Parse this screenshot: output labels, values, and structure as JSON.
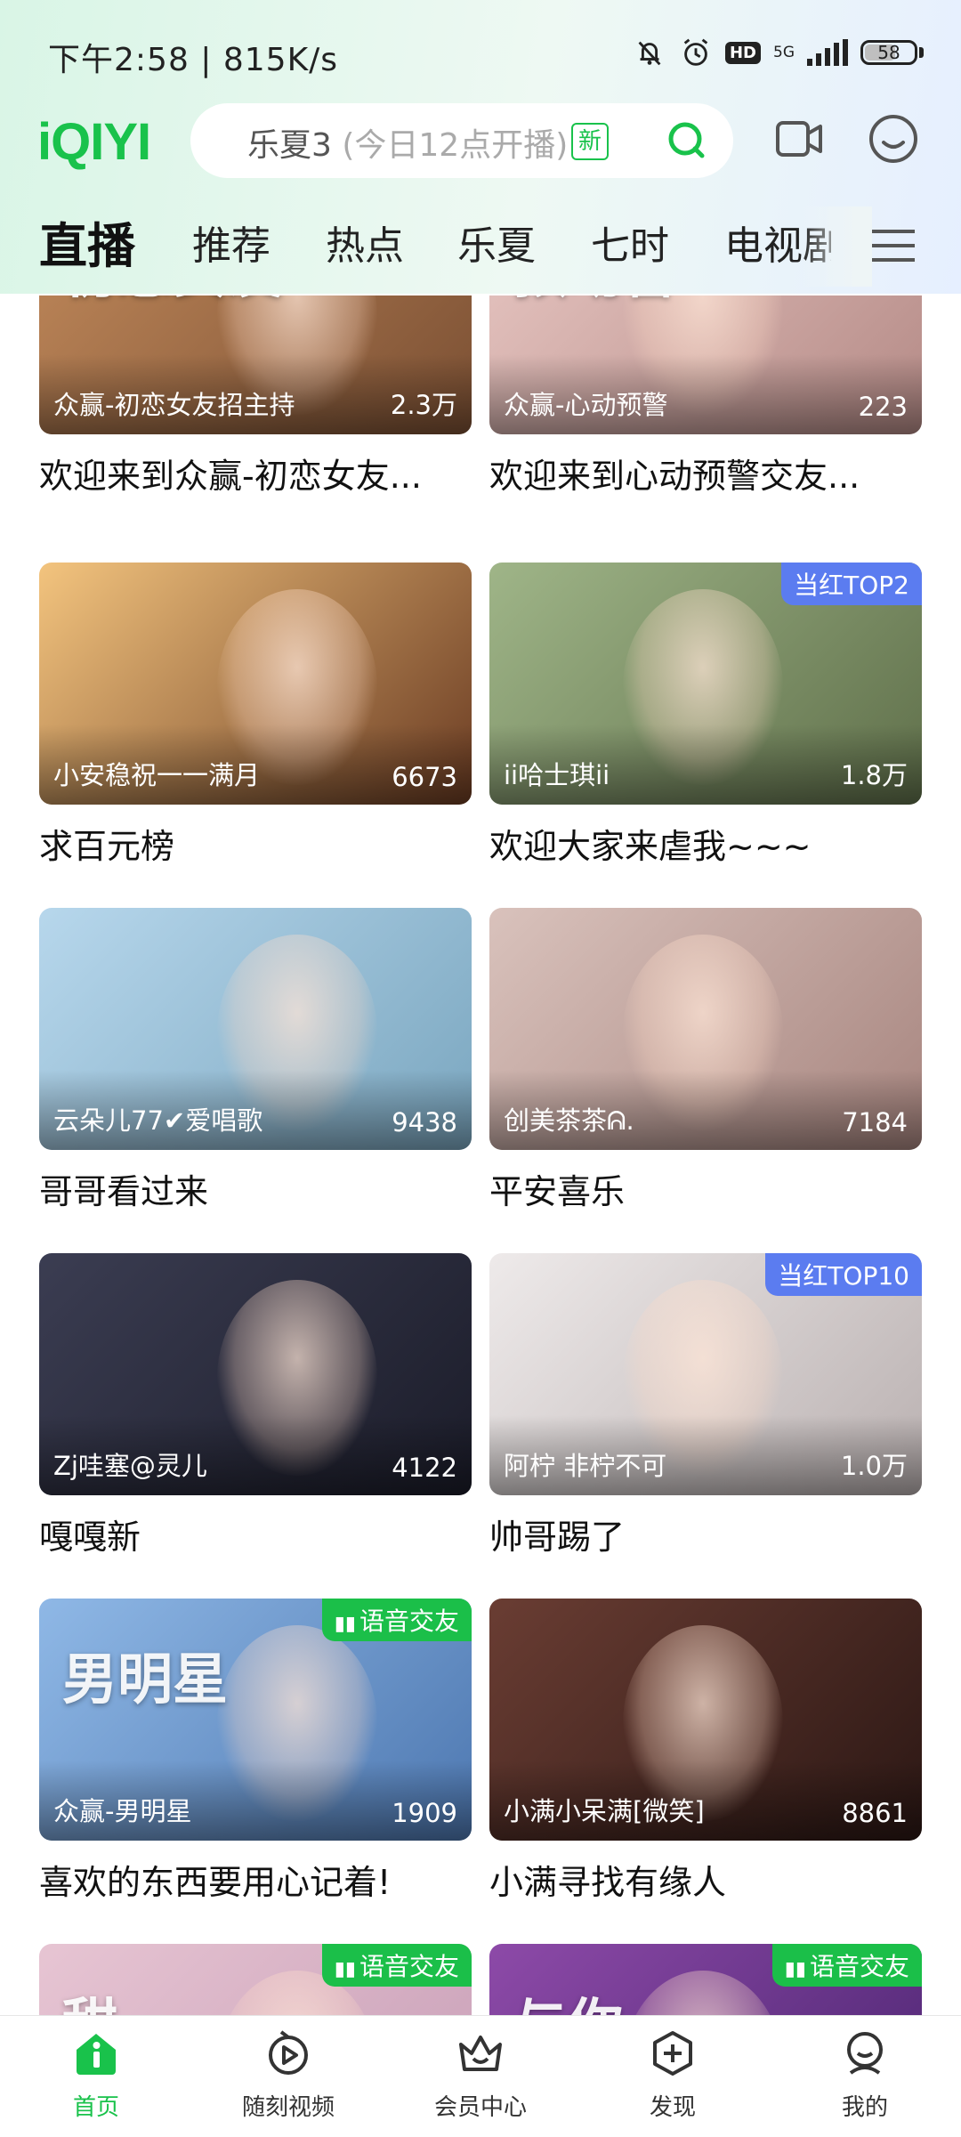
{
  "status_bar": {
    "time": "下午2:58 | 815K/s",
    "network": "5G",
    "hd": "HD",
    "battery": "58"
  },
  "header": {
    "logo": "iQIYI",
    "search_main": "乐夏3",
    "search_hint": " (今日12点开播)",
    "search_new_tag": "新",
    "icons": [
      "search-icon",
      "video-call-icon",
      "profile-icon"
    ]
  },
  "tabs": [
    "直播",
    "推荐",
    "热点",
    "乐夏",
    "七时",
    "电视剧"
  ],
  "cards": [
    {
      "host": "众赢-初恋女友招主持",
      "count": "2.3万",
      "title": "欢迎来到众赢-初恋女友...",
      "badge": "",
      "overlay": "初恋女友",
      "color1": "#c28a5b",
      "color2": "#7a4f33"
    },
    {
      "host": "众赢-心动预警",
      "count": "223",
      "title": "欢迎来到心动预警交友...",
      "badge": "",
      "overlay": "预动警",
      "color1": "#e9c8c4",
      "color2": "#b48a86"
    },
    {
      "host": "小安稳祝一一满月",
      "count": "6673",
      "title": "求百元榜",
      "badge": "",
      "overlay": "",
      "color1": "#f3c47e",
      "color2": "#6a3b22"
    },
    {
      "host": "ii哈士琪ii",
      "count": "1.8万",
      "title": "欢迎大家来虐我~~~",
      "badge": "当红TOP2",
      "badge_type": "top",
      "overlay": "",
      "color1": "#9fb588",
      "color2": "#5f6f4a"
    },
    {
      "host": "云朵儿77✔爱唱歌",
      "count": "9438",
      "title": "哥哥看过来",
      "badge": "",
      "overlay": "",
      "color1": "#b7d7ec",
      "color2": "#7aa6bf"
    },
    {
      "host": "创美茶茶ᕱ.",
      "count": "7184",
      "title": "平安喜乐",
      "badge": "",
      "overlay": "",
      "color1": "#d9c2bc",
      "color2": "#a7857f"
    },
    {
      "host": "Zj哇塞@灵儿",
      "count": "4122",
      "title": "嘎嘎新",
      "badge": "",
      "overlay": "",
      "color1": "#3b3d52",
      "color2": "#1b1c29"
    },
    {
      "host": "阿柠  非柠不可",
      "count": "1.0万",
      "title": "帅哥踢了",
      "badge": "当红TOP10",
      "badge_type": "top",
      "overlay": "",
      "color1": "#eeeaea",
      "color2": "#b9b0b0"
    },
    {
      "host": "众赢-男明星",
      "count": "1909",
      "title": "喜欢的东西要用心记着!",
      "badge": "语音交友",
      "badge_type": "voice",
      "overlay": "男明星",
      "color1": "#8fb8e6",
      "color2": "#4d77b0"
    },
    {
      "host": "小满小呆满[微笑]",
      "count": "8861",
      "title": "小满寻找有缘人",
      "badge": "",
      "overlay": "",
      "color1": "#6a3d33",
      "color2": "#2b1714"
    },
    {
      "host": "",
      "count": "",
      "title": "",
      "badge": "语音交友",
      "badge_type": "voice",
      "overlay": "甜",
      "color1": "#e7c5d3",
      "color2": "#c79db6"
    },
    {
      "host": "",
      "count": "",
      "title": "",
      "badge": "语音交友",
      "badge_type": "voice",
      "overlay": "与你",
      "color1": "#8d4aa8",
      "color2": "#4a2470"
    }
  ],
  "bottom_nav": [
    {
      "label": "首页",
      "icon": "home-icon",
      "active": true
    },
    {
      "label": "随刻视频",
      "icon": "play-circle-icon",
      "active": false
    },
    {
      "label": "会员中心",
      "icon": "crown-icon",
      "active": false
    },
    {
      "label": "发现",
      "icon": "discover-plus-icon",
      "active": false
    },
    {
      "label": "我的",
      "icon": "me-icon",
      "active": false
    }
  ],
  "colors": {
    "brand_green": "#19c24b",
    "top_badge": "#5b7cf0",
    "voice_badge": "#1bbf49"
  }
}
